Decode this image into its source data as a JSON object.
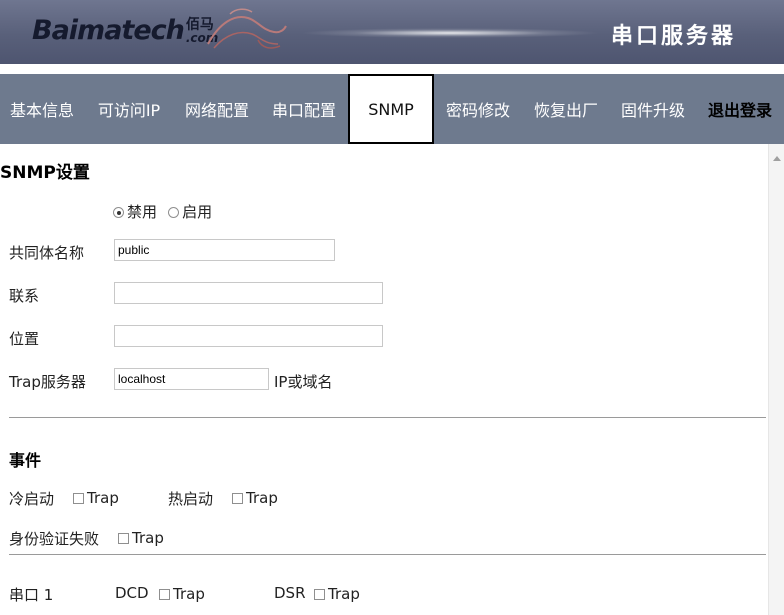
{
  "header": {
    "logo_text": "Baimatech",
    "logo_cn": "佰马",
    "logo_com": ".com",
    "title": "串口服务器"
  },
  "nav": {
    "items": [
      {
        "label": "基本信息"
      },
      {
        "label": "可访问IP"
      },
      {
        "label": "网络配置"
      },
      {
        "label": "串口配置"
      },
      {
        "label": "SNMP",
        "active": true
      },
      {
        "label": "密码修改"
      },
      {
        "label": "恢复出厂"
      },
      {
        "label": "固件升级"
      },
      {
        "label": "退出登录"
      }
    ]
  },
  "snmp": {
    "section_title": "SNMP设置",
    "mode": {
      "disable_label": "禁用",
      "enable_label": "启用",
      "selected": "禁用"
    },
    "community_label": "共同体名称",
    "community_value": "public",
    "contact_label": "联系",
    "contact_value": "",
    "location_label": "位置",
    "location_value": "",
    "trap_server_label": "Trap服务器",
    "trap_server_value": "localhost",
    "trap_server_hint": "IP或域名"
  },
  "events": {
    "section_title": "事件",
    "cold_start_label": "冷启动",
    "warm_start_label": "热启动",
    "auth_fail_label": "身份验证失败",
    "trap_label": "Trap"
  },
  "serial": {
    "port_label": "串口 1",
    "dcd_label": "DCD",
    "dsr_label": "DSR"
  }
}
